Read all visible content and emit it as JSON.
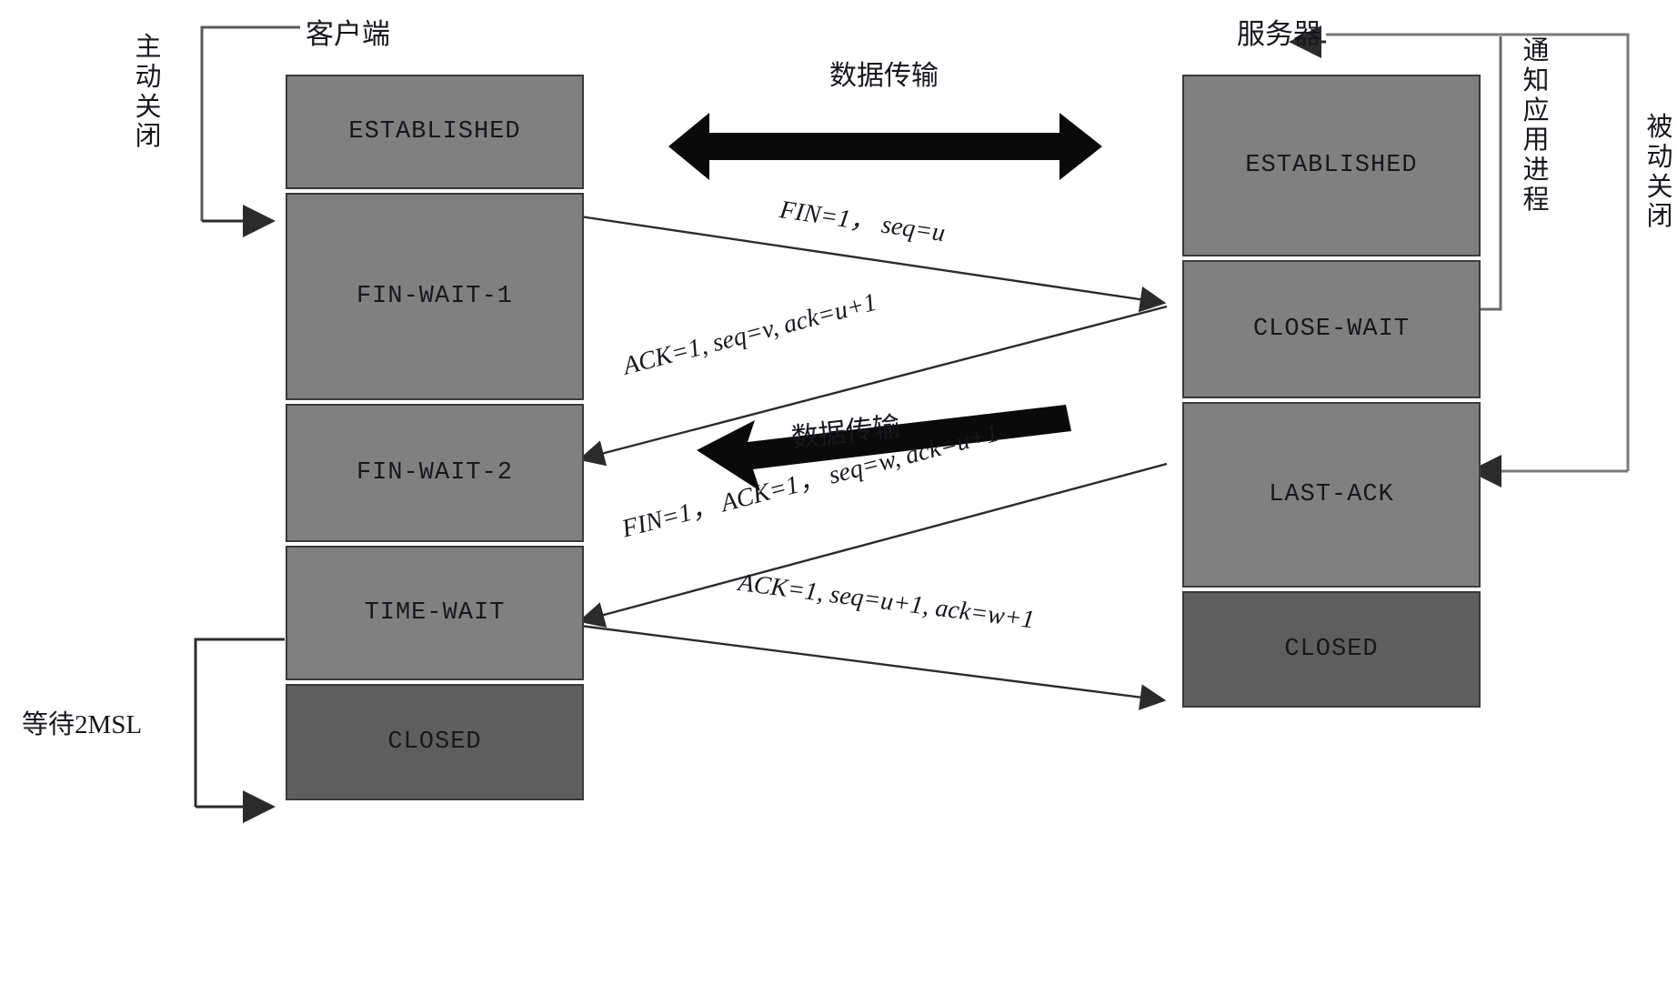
{
  "diagram": {
    "title_client": "客户端",
    "title_server": "服务器",
    "annotations": {
      "active_close": "主动关闭",
      "passive_close": "被动关闭",
      "notify_app": "通知应用进程",
      "wait_2msl": "等待2MSL"
    },
    "data_transfer_top": "数据传输",
    "data_transfer_bottom": "数据传输"
  },
  "client_states": [
    {
      "label": "ESTABLISHED",
      "kind": "active"
    },
    {
      "label": "FIN-WAIT-1",
      "kind": "active"
    },
    {
      "label": "FIN-WAIT-2",
      "kind": "active"
    },
    {
      "label": "TIME-WAIT",
      "kind": "active"
    },
    {
      "label": "CLOSED",
      "kind": "closed"
    }
  ],
  "server_states": [
    {
      "label": "ESTABLISHED",
      "kind": "active"
    },
    {
      "label": "CLOSE-WAIT",
      "kind": "active"
    },
    {
      "label": "LAST-ACK",
      "kind": "active"
    },
    {
      "label": "CLOSED",
      "kind": "closed"
    }
  ],
  "messages": [
    {
      "text": "FIN=1， seq=u",
      "direction": "client-to-server"
    },
    {
      "text": "ACK=1, seq=v, ack=u+1",
      "direction": "server-to-client"
    },
    {
      "text": "FIN=1， ACK=1， seq=w, ack=u+1",
      "direction": "server-to-client"
    },
    {
      "text": "ACK=1, seq=u+1, ack=w+1",
      "direction": "client-to-server"
    }
  ],
  "colors": {
    "box_fill": "#808080",
    "box_fill_closed": "#5e5e5e",
    "box_stroke": "#3a3a3a",
    "line": "#2b2b2b",
    "text": "#17171d",
    "background": "#ffffff"
  }
}
